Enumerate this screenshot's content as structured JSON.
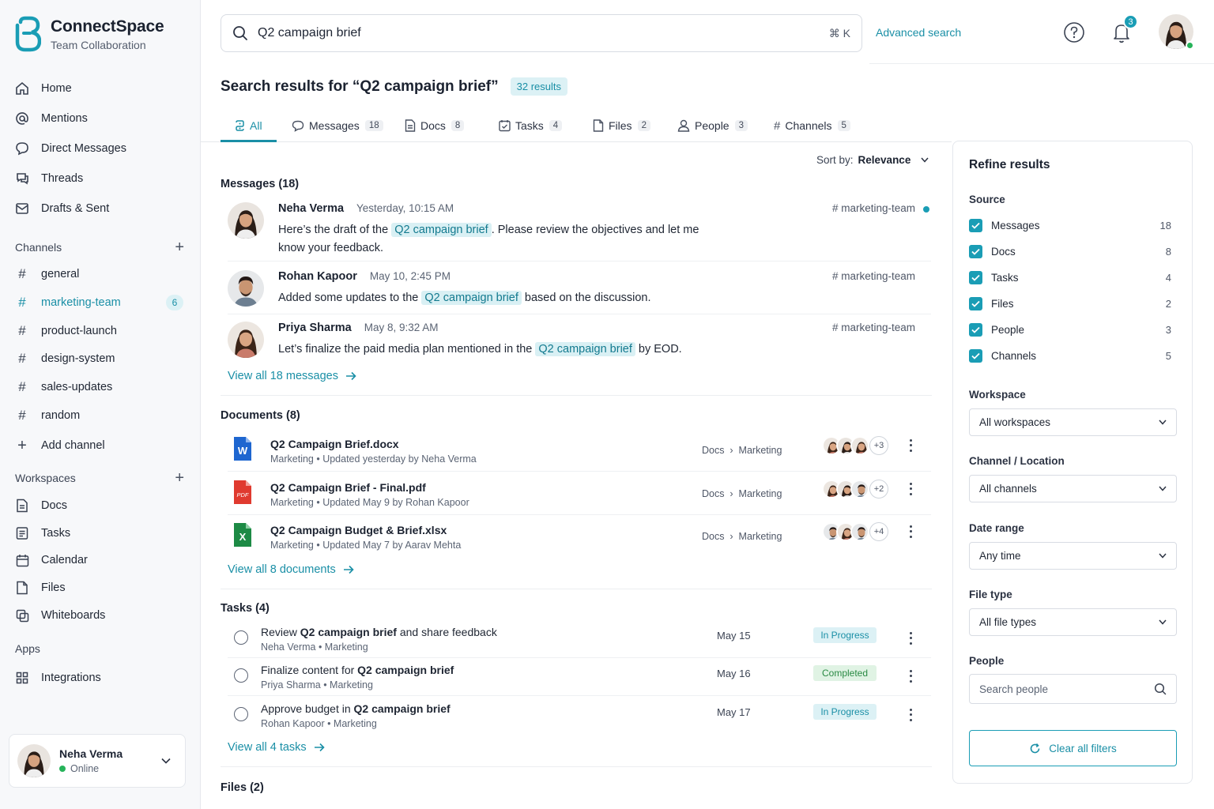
{
  "brand": {
    "name": "ConnectSpace",
    "subtitle": "Team Collaboration"
  },
  "nav": [
    {
      "label": "Home",
      "icon": "home-icon"
    },
    {
      "label": "Mentions",
      "icon": "at-icon"
    },
    {
      "label": "Direct Messages",
      "icon": "chat-bubble-icon"
    },
    {
      "label": "Threads",
      "icon": "threads-icon"
    },
    {
      "label": "Drafts & Sent",
      "icon": "send-icon"
    }
  ],
  "channels": {
    "heading": "Channels",
    "items": [
      {
        "label": "general"
      },
      {
        "label": "marketing-team",
        "badge": "6",
        "active": true
      },
      {
        "label": "product-launch"
      },
      {
        "label": "design-system"
      },
      {
        "label": "sales-updates"
      },
      {
        "label": "random"
      }
    ],
    "add_label": "Add channel"
  },
  "workspaces": {
    "heading": "Workspaces",
    "items": [
      {
        "label": "Docs",
        "icon": "document-icon"
      },
      {
        "label": "Tasks",
        "icon": "tasks-icon"
      },
      {
        "label": "Calendar",
        "icon": "calendar-icon"
      },
      {
        "label": "Files",
        "icon": "file-icon"
      },
      {
        "label": "Whiteboards",
        "icon": "whiteboard-icon"
      }
    ]
  },
  "apps": {
    "heading": "Apps",
    "items": [
      {
        "label": "Integrations",
        "icon": "grid-icon"
      }
    ]
  },
  "user": {
    "name": "Neha Verma",
    "status": "Online"
  },
  "header": {
    "search_value": "Q2 campaign brief",
    "shortcut": "⌘ K",
    "advanced_search": "Advanced search",
    "notification_count": "3"
  },
  "results": {
    "title": "Search results for “Q2 campaign brief”",
    "count": "32 results"
  },
  "tabs": [
    {
      "label": "All",
      "count": "",
      "icon": "all-icon",
      "active": true
    },
    {
      "label": "Messages",
      "count": "18",
      "icon": "message-icon"
    },
    {
      "label": "Docs",
      "count": "8",
      "icon": "document-icon"
    },
    {
      "label": "Tasks",
      "count": "4",
      "icon": "tasks-icon"
    },
    {
      "label": "Files",
      "count": "2",
      "icon": "file-icon"
    },
    {
      "label": "People",
      "count": "3",
      "icon": "person-icon"
    },
    {
      "label": "Channels",
      "count": "5",
      "icon": "hash-icon"
    }
  ],
  "sort": {
    "label": "Sort by:",
    "value": "Relevance"
  },
  "messages": {
    "title": "Messages (18)",
    "items": [
      {
        "name": "Neha Verma",
        "time": "Yesterday, 10:15 AM",
        "channel": "# marketing-team",
        "pre": "Here’s the draft of the ",
        "hl": "Q2 campaign brief",
        "post": ". Please review the objectives and let me know your feedback.",
        "unread": true
      },
      {
        "name": "Rohan Kapoor",
        "time": "May 10, 2:45 PM",
        "channel": "# marketing-team",
        "pre": "Added some updates to the ",
        "hl": "Q2 campaign brief",
        "post": " based on the discussion."
      },
      {
        "name": "Priya Sharma",
        "time": "May 8, 9:32 AM",
        "channel": "# marketing-team",
        "pre": "Let’s finalize the paid media plan mentioned in the ",
        "hl": "Q2 campaign brief",
        "post": " by EOD."
      }
    ],
    "view_all": "View all 18 messages"
  },
  "documents": {
    "title": "Documents (8)",
    "items": [
      {
        "name": "Q2 Campaign Brief.docx",
        "meta": "Marketing  •  Updated yesterday by Neha Verma",
        "path_a": "Docs",
        "path_b": "Marketing",
        "more": "+3",
        "type": "word"
      },
      {
        "name": "Q2 Campaign Brief - Final.pdf",
        "meta": "Marketing  •  Updated  May 9 by Rohan Kapoor",
        "path_a": "Docs",
        "path_b": "Marketing",
        "more": "+2",
        "type": "pdf"
      },
      {
        "name": "Q2 Campaign Budget & Brief.xlsx",
        "meta": "Marketing  •  Updated  May 7 by Aarav Mehta",
        "path_a": "Docs",
        "path_b": "Marketing",
        "more": "+4",
        "type": "excel"
      }
    ],
    "view_all": "View all 8 documents"
  },
  "tasks": {
    "title": "Tasks (4)",
    "items": [
      {
        "pre": "Review ",
        "bold": "Q2 campaign brief",
        "post": " and share feedback",
        "meta": "Neha Verma  •  Marketing",
        "date": "May 15",
        "status": "In Progress"
      },
      {
        "pre": "Finalize content for ",
        "bold": "Q2 campaign brief",
        "post": "",
        "meta": "Priya Sharma  •  Marketing",
        "date": "May 16",
        "status": "Completed"
      },
      {
        "pre": "Approve budget in ",
        "bold": "Q2 campaign brief",
        "post": "",
        "meta": "Rohan Kapoor  •  Marketing",
        "date": "May 17",
        "status": "In Progress"
      }
    ],
    "view_all": "View all 4 tasks"
  },
  "files": {
    "title": "Files (2)"
  },
  "refine": {
    "title": "Refine results",
    "source_label": "Source",
    "sources": [
      {
        "label": "Messages",
        "count": "18"
      },
      {
        "label": "Docs",
        "count": "8"
      },
      {
        "label": "Tasks",
        "count": "4"
      },
      {
        "label": "Files",
        "count": "2"
      },
      {
        "label": "People",
        "count": "3"
      },
      {
        "label": "Channels",
        "count": "5"
      }
    ],
    "workspace_label": "Workspace",
    "workspace_value": "All workspaces",
    "channel_label": "Channel / Location",
    "channel_value": "All channels",
    "date_label": "Date range",
    "date_value": "Any time",
    "filetype_label": "File type",
    "filetype_value": "All file types",
    "people_label": "People",
    "people_placeholder": "Search people",
    "clear_label": "Clear all filters"
  },
  "colors": {
    "accent": "#1a8fa6",
    "accent_bg": "#dcf1f5",
    "success": "#2a8a44"
  }
}
